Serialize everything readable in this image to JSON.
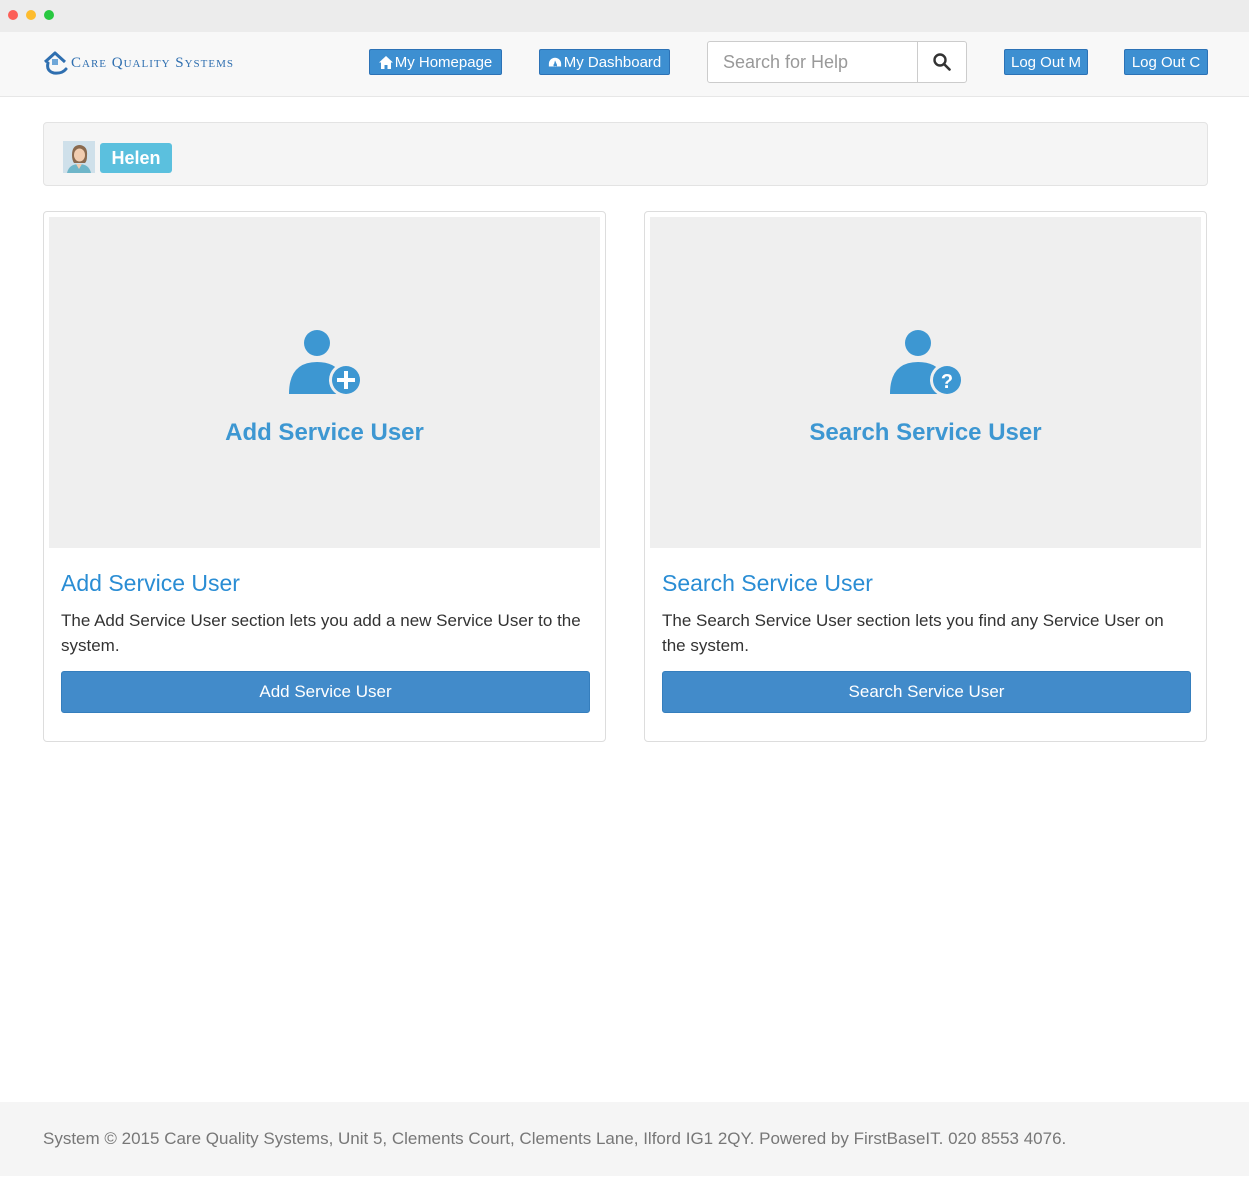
{
  "brand": {
    "name": "Care Quality Systems",
    "accent_color": "#2f6fb0",
    "logo_icon": "house-hand-logo-icon"
  },
  "nav": {
    "homepage_label": "My Homepage",
    "homepage_icon": "home-icon",
    "dashboard_label": "My Dashboard",
    "dashboard_icon": "dashboard-icon",
    "search_placeholder": "Search for Help",
    "search_icon": "search-icon",
    "logout_m_label": "Log Out M",
    "logout_c_label": "Log Out C",
    "button_color": "#3d8fd1"
  },
  "user": {
    "name": "Helen",
    "badge_color": "#5bc0de",
    "avatar_icon": "user-photo-avatar"
  },
  "cards": [
    {
      "hero_icon": "add-user-icon",
      "hero_title": "Add Service User",
      "title": "Add Service User",
      "description": "The Add Service User section lets you add a new Service User to the system.",
      "button_label": "Add Service User"
    },
    {
      "hero_icon": "search-user-icon",
      "hero_title": "Search Service User",
      "title": "Search Service User",
      "description": "The Search Service User section lets you find any Service User on the system.",
      "button_label": "Search Service User"
    }
  ],
  "footer": {
    "text": "System © 2015 Care Quality Systems, Unit 5, Clements Court, Clements Lane, Ilford IG1 2QY. Powered by FirstBaseIT. 020 8553 4076."
  }
}
